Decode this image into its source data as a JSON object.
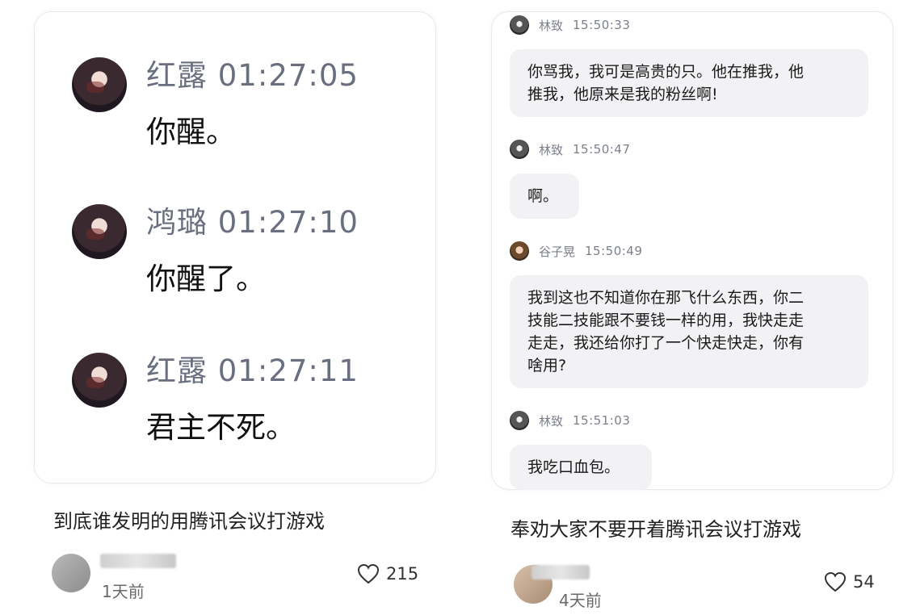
{
  "left_post": {
    "chat": [
      {
        "name": "红露",
        "time": "01:27:05",
        "text": "你醒。"
      },
      {
        "name": "鸿璐",
        "time": "01:27:10",
        "text": "你醒了。"
      },
      {
        "name": "红露",
        "time": "01:27:11",
        "text": "君主不死。"
      }
    ],
    "caption": "到底谁发明的用腾讯会议打游戏",
    "date": "1天前",
    "likes": "215"
  },
  "right_post": {
    "chat": [
      {
        "name": "林致",
        "time": "15:50:33",
        "lines": [
          "你骂我，我可是高贵的只。他在推我，他",
          "推我，他原来是我的粉丝啊!"
        ]
      },
      {
        "name": "林致",
        "time": "15:50:47",
        "lines": [
          "啊。"
        ]
      },
      {
        "name": "谷子晃",
        "time": "15:50:49",
        "lines": [
          "我到这也不知道你在那飞什么东西，你二",
          "技能二技能跟不要钱一样的用，我快走走",
          "走走，我还给你打了一个快走快走，你有",
          "啥用?"
        ]
      },
      {
        "name": "林致",
        "time": "15:51:03",
        "lines": [
          "我吃口血包。"
        ]
      }
    ],
    "caption": "奉劝大家不要开着腾讯会议打游戏",
    "date": "4天前",
    "likes": "54"
  },
  "icons": {
    "like": "heart-outline-icon",
    "avatar": "user-avatar-icon"
  }
}
